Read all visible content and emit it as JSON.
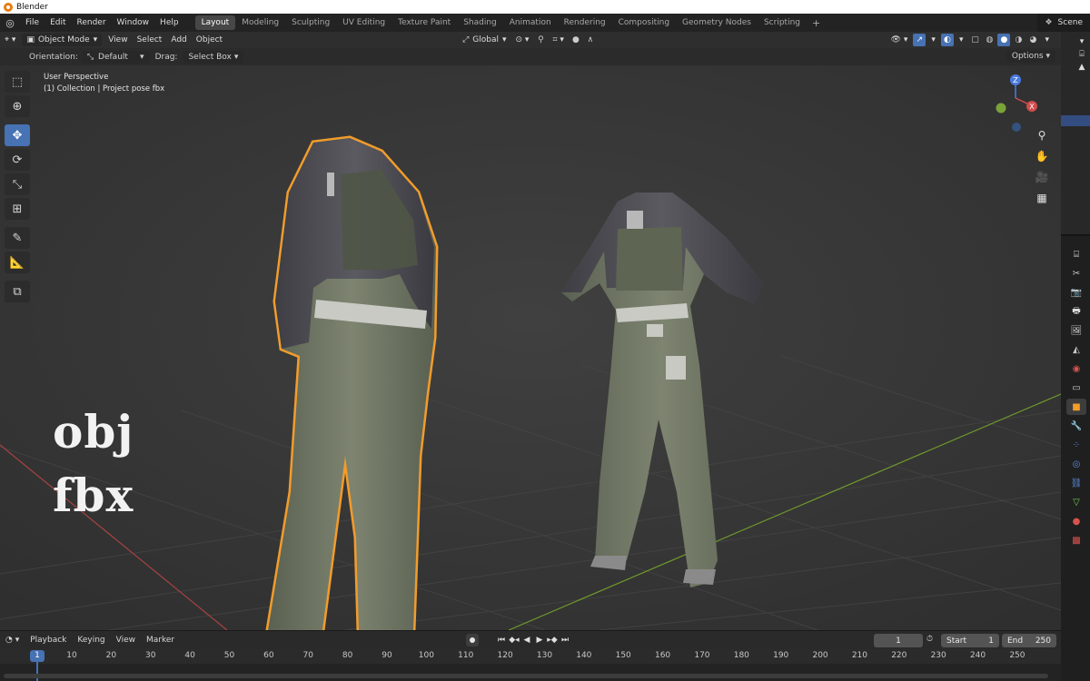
{
  "window": {
    "title": "Blender"
  },
  "menu": [
    "File",
    "Edit",
    "Render",
    "Window",
    "Help"
  ],
  "workspaces": [
    "Layout",
    "Modeling",
    "Sculpting",
    "UV Editing",
    "Texture Paint",
    "Shading",
    "Animation",
    "Rendering",
    "Compositing",
    "Geometry Nodes",
    "Scripting"
  ],
  "active_workspace": "Layout",
  "scene_name": "Scene",
  "viewport_header": {
    "mode": "Object Mode",
    "menus": [
      "View",
      "Select",
      "Add",
      "Object"
    ],
    "transform_orientation": "Global"
  },
  "tool_settings": {
    "orientation_label": "Orientation:",
    "orientation_value": "Default",
    "drag_label": "Drag:",
    "drag_value": "Select Box",
    "options_label": "Options"
  },
  "viewport": {
    "perspective": "User Perspective",
    "collection_info": "(1) Collection | Project pose fbx",
    "overlay_label_1": "obj",
    "overlay_label_2": "fbx",
    "gizmo_axes": {
      "z": "Z",
      "x": "X"
    }
  },
  "timeline": {
    "menus": [
      "Playback",
      "Keying",
      "View",
      "Marker"
    ],
    "current_frame": "1",
    "start_label": "Start",
    "start_value": "1",
    "end_label": "End",
    "end_value": "250",
    "ruler_marks": [
      "1",
      "10",
      "20",
      "30",
      "40",
      "50",
      "60",
      "70",
      "80",
      "90",
      "100",
      "110",
      "120",
      "130",
      "140",
      "150",
      "160",
      "170",
      "180",
      "190",
      "200",
      "210",
      "220",
      "230",
      "240",
      "250"
    ]
  },
  "colors": {
    "selection_outline": "#f29c2b",
    "active_blue": "#4772b3",
    "x_axis": "#c84a4a",
    "y_axis": "#7aa33a"
  }
}
